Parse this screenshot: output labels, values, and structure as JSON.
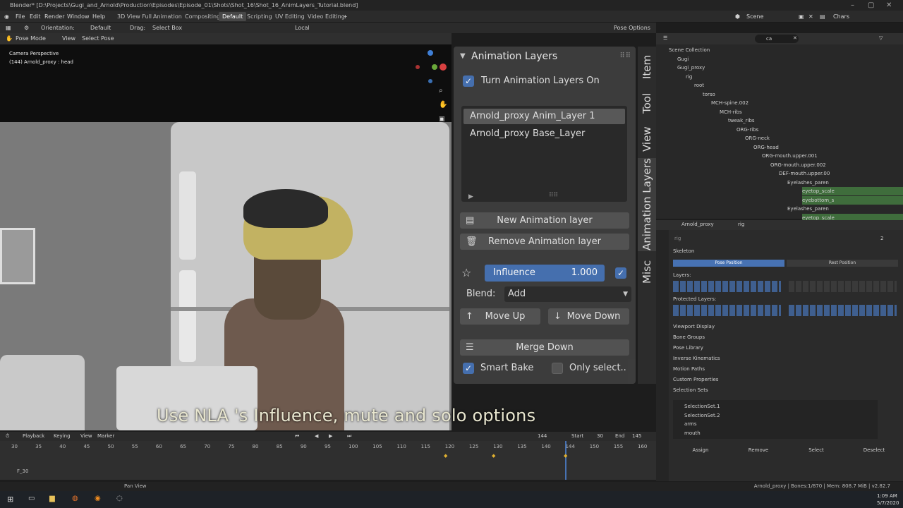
{
  "window": {
    "title": "Blender* [D:\\Projects\\Gugi_and_Arnold\\Production\\Episodes\\Episode_01\\Shots\\Shot_16\\Shot_16_AnimLayers_Tutorial.blend]"
  },
  "menu": {
    "items": [
      "File",
      "Edit",
      "Render",
      "Window",
      "Help"
    ],
    "workspaces": [
      "3D View Full",
      "Animation",
      "Compositing",
      "Default",
      "Scripting",
      "UV Editing",
      "Video Editing"
    ],
    "active_workspace": "Default",
    "scene_label": "Scene",
    "chars_label": "Chars"
  },
  "header3d": {
    "orientation_label": "Orientation:",
    "orientation_value": "Default",
    "drag_label": "Drag:",
    "drag_value": "Select Box",
    "pivot_value": "Local",
    "pose_options": "Pose Options"
  },
  "modebar": {
    "mode": "Pose Mode",
    "view": "View",
    "select": "Select",
    "pose": "Pose"
  },
  "viewport": {
    "camera": "Camera Perspective",
    "object": "(144) Arnold_proxy : head"
  },
  "subtitle": "Use NLA 's Influence, mute and solo options",
  "anim_layers": {
    "title": "Animation Layers",
    "turn_on_label": "Turn Animation Layers On",
    "layers": [
      "Arnold_proxy Anim_Layer 1",
      "Arnold_proxy Base_Layer"
    ],
    "new_label": "New Animation layer",
    "remove_label": "Remove Animation layer",
    "influence_label": "Influence",
    "influence_value": "1.000",
    "blend_label": "Blend:",
    "blend_value": "Add",
    "move_up": "Move Up",
    "move_down": "Move Down",
    "merge_down": "Merge Down",
    "smart_bake": "Smart Bake",
    "only_selected": "Only select.."
  },
  "side_tabs": [
    "Item",
    "Tool",
    "View",
    "Animation Layers",
    "Misc"
  ],
  "outliner": {
    "search": "ca",
    "rows": [
      {
        "label": "Scene Collection",
        "indent": 0
      },
      {
        "label": "Gugi",
        "indent": 1
      },
      {
        "label": "Gugi_proxy",
        "indent": 1
      },
      {
        "label": "rig",
        "indent": 2
      },
      {
        "label": "root",
        "indent": 3
      },
      {
        "label": "torso",
        "indent": 4
      },
      {
        "label": "MCH-spine.002",
        "indent": 5
      },
      {
        "label": "MCH-ribs",
        "indent": 6
      },
      {
        "label": "tweak_ribs",
        "indent": 7
      },
      {
        "label": "ORG-ribs",
        "indent": 8
      },
      {
        "label": "ORG-neck",
        "indent": 9
      },
      {
        "label": "ORG-head",
        "indent": 10
      },
      {
        "label": "ORG-mouth.upper.001",
        "indent": 11
      },
      {
        "label": "ORG-mouth.upper.002",
        "indent": 12
      },
      {
        "label": "DEF-mouth.upper.00",
        "indent": 13
      },
      {
        "label": "Eyelashes_paren",
        "indent": 14
      },
      {
        "label": "eyetop_scale",
        "indent": 15,
        "hl": true
      },
      {
        "label": "eyebottom_s",
        "indent": 15,
        "hl": true
      },
      {
        "label": "Eyelashes_paren",
        "indent": 14
      },
      {
        "label": "eyetop_scale",
        "indent": 15,
        "hl": true
      },
      {
        "label": "eyebottom_s",
        "indent": 15,
        "hl": true
      }
    ]
  },
  "properties": {
    "object": "Arnold_proxy",
    "data": "rig",
    "users": "2",
    "skeleton": "Skeleton",
    "pose_position": "Pose Position",
    "rest_position": "Rest Position",
    "layers": "Layers:",
    "protected_layers": "Protected Layers:",
    "sections": [
      "Viewport Display",
      "Bone Groups",
      "Pose Library",
      "Inverse Kinematics",
      "Motion Paths",
      "Custom Properties",
      "Selection Sets"
    ],
    "selection_sets": [
      "SelectionSet.1",
      "SelectionSet.2",
      "arms",
      "mouth"
    ],
    "buttons": [
      "Assign",
      "Remove",
      "Select",
      "Deselect"
    ]
  },
  "timeline": {
    "menu": [
      "Playback",
      "Keying",
      "View",
      "Marker"
    ],
    "current_frame": "144",
    "start_label": "Start",
    "start": "30",
    "end_label": "End",
    "end": "145",
    "ticks": [
      "30",
      "35",
      "40",
      "45",
      "50",
      "55",
      "60",
      "65",
      "70",
      "75",
      "80",
      "85",
      "90",
      "95",
      "100",
      "105",
      "110",
      "115",
      "120",
      "125",
      "130",
      "135",
      "140",
      "144",
      "150",
      "155",
      "160"
    ],
    "marker": "F_30"
  },
  "status": {
    "left": "Pan View",
    "right": "Arnold_proxy | Bones:1/870 | Mem: 808.7 MiB | v2.82.7"
  },
  "taskbar": {
    "time": "1:09 AM",
    "date": "5/7/2020"
  }
}
